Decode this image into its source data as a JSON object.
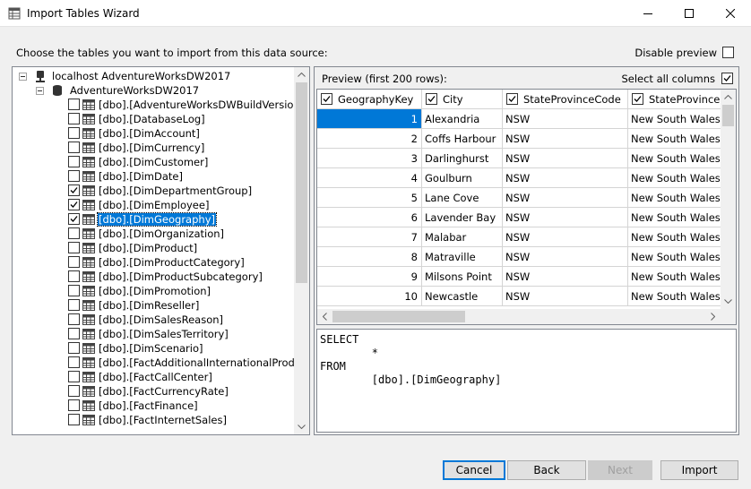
{
  "window": {
    "title": "Import Tables Wizard"
  },
  "prompt": "Choose the tables you want to import from this data source:",
  "disable_preview": {
    "label": "Disable preview",
    "checked": false
  },
  "tree": {
    "server": "localhost AdventureWorksDW2017",
    "database": "AdventureWorksDW2017",
    "tables": [
      {
        "name": "[dbo].[AdventureWorksDWBuildVersion]",
        "checked": false
      },
      {
        "name": "[dbo].[DatabaseLog]",
        "checked": false
      },
      {
        "name": "[dbo].[DimAccount]",
        "checked": false
      },
      {
        "name": "[dbo].[DimCurrency]",
        "checked": false
      },
      {
        "name": "[dbo].[DimCustomer]",
        "checked": false
      },
      {
        "name": "[dbo].[DimDate]",
        "checked": false
      },
      {
        "name": "[dbo].[DimDepartmentGroup]",
        "checked": true
      },
      {
        "name": "[dbo].[DimEmployee]",
        "checked": true
      },
      {
        "name": "[dbo].[DimGeography]",
        "checked": true,
        "selected": true
      },
      {
        "name": "[dbo].[DimOrganization]",
        "checked": false
      },
      {
        "name": "[dbo].[DimProduct]",
        "checked": false
      },
      {
        "name": "[dbo].[DimProductCategory]",
        "checked": false
      },
      {
        "name": "[dbo].[DimProductSubcategory]",
        "checked": false
      },
      {
        "name": "[dbo].[DimPromotion]",
        "checked": false
      },
      {
        "name": "[dbo].[DimReseller]",
        "checked": false
      },
      {
        "name": "[dbo].[DimSalesReason]",
        "checked": false
      },
      {
        "name": "[dbo].[DimSalesTerritory]",
        "checked": false
      },
      {
        "name": "[dbo].[DimScenario]",
        "checked": false
      },
      {
        "name": "[dbo].[FactAdditionalInternationalProductDes",
        "checked": false
      },
      {
        "name": "[dbo].[FactCallCenter]",
        "checked": false
      },
      {
        "name": "[dbo].[FactCurrencyRate]",
        "checked": false
      },
      {
        "name": "[dbo].[FactFinance]",
        "checked": false
      },
      {
        "name": "[dbo].[FactInternetSales]",
        "checked": false
      }
    ]
  },
  "preview": {
    "caption": "Preview (first 200 rows):",
    "select_all_label": "Select all columns",
    "select_all_checked": true,
    "columns": [
      {
        "name": "GeographyKey",
        "checked": true
      },
      {
        "name": "City",
        "checked": true
      },
      {
        "name": "StateProvinceCode",
        "checked": true
      },
      {
        "name": "StateProvinceName",
        "checked": true
      }
    ],
    "rows": [
      [
        "1",
        "Alexandria",
        "NSW",
        "New South Wales"
      ],
      [
        "2",
        "Coffs Harbour",
        "NSW",
        "New South Wales"
      ],
      [
        "3",
        "Darlinghurst",
        "NSW",
        "New South Wales"
      ],
      [
        "4",
        "Goulburn",
        "NSW",
        "New South Wales"
      ],
      [
        "5",
        "Lane Cove",
        "NSW",
        "New South Wales"
      ],
      [
        "6",
        "Lavender Bay",
        "NSW",
        "New South Wales"
      ],
      [
        "7",
        "Malabar",
        "NSW",
        "New South Wales"
      ],
      [
        "8",
        "Matraville",
        "NSW",
        "New South Wales"
      ],
      [
        "9",
        "Milsons Point",
        "NSW",
        "New South Wales"
      ],
      [
        "10",
        "Newcastle",
        "NSW",
        "New South Wales"
      ]
    ]
  },
  "sql": "SELECT\n        *\nFROM\n        [dbo].[DimGeography]",
  "buttons": {
    "cancel": "Cancel",
    "back": "Back",
    "next": "Next",
    "import": "Import"
  }
}
